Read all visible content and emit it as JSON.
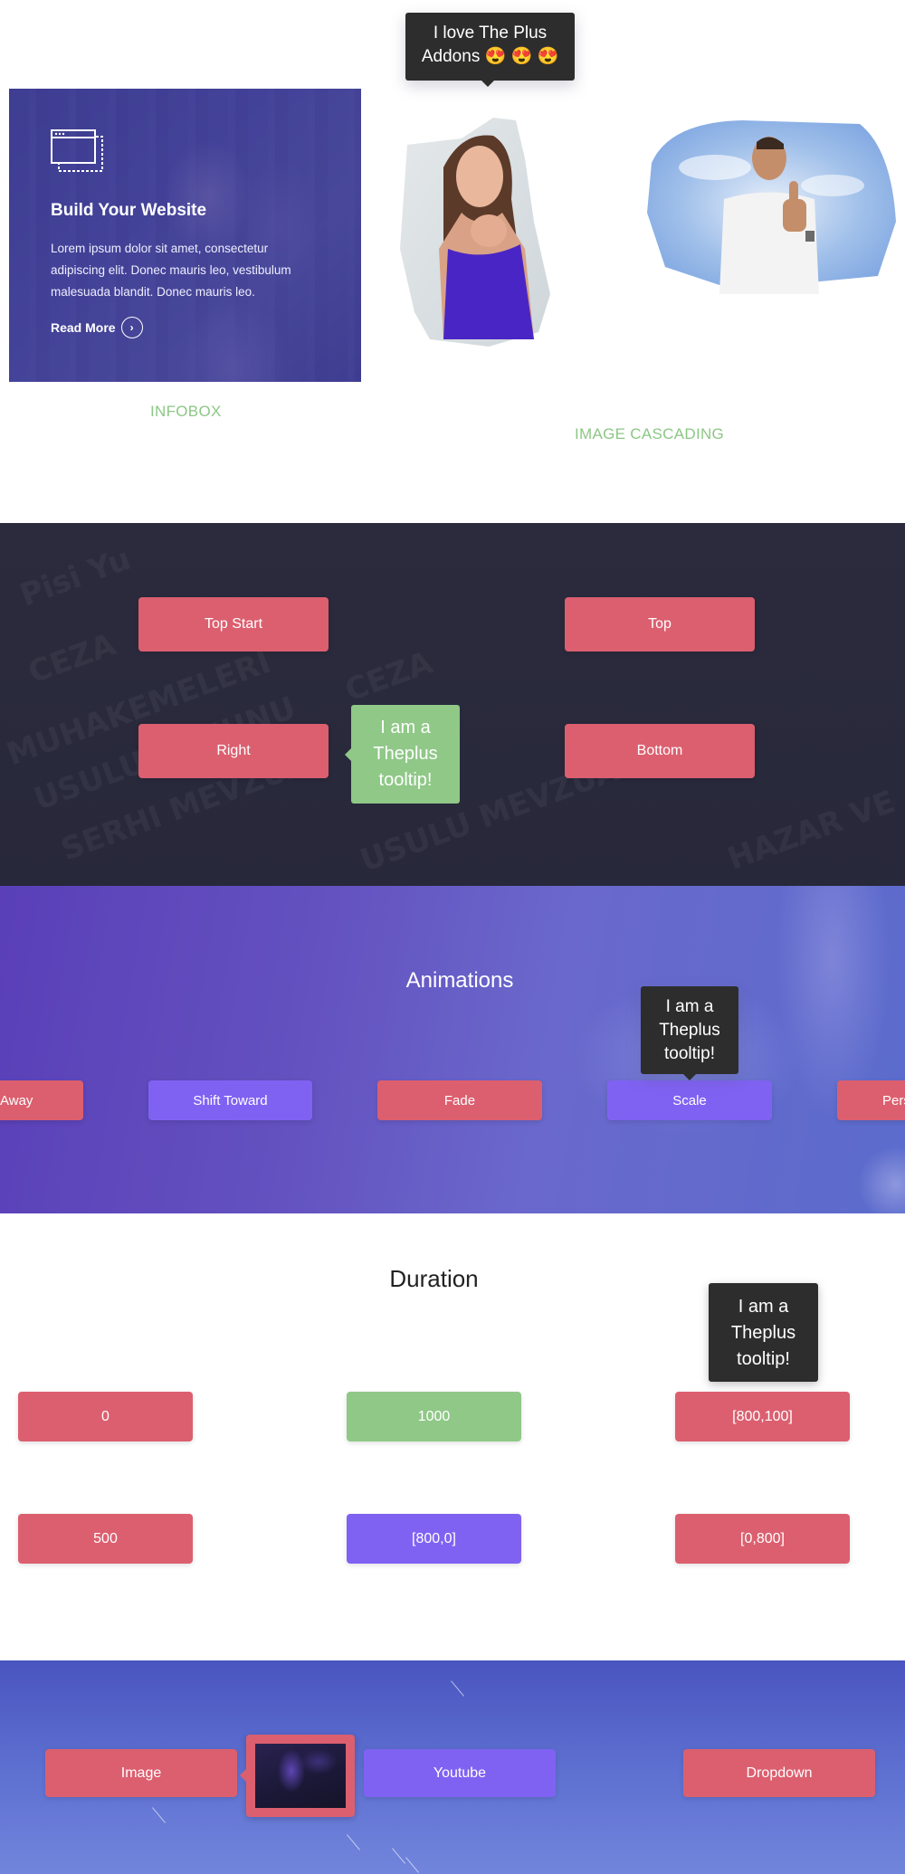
{
  "infobox": {
    "title": "Build Your Website",
    "text": "Lorem ipsum dolor sit amet, consectetur adipiscing elit. Donec mauris leo, vestibulum malesuada blandit. Donec mauris leo.",
    "read_more": "Read More",
    "icon": "browser-window-icon",
    "caption": "INFOBOX"
  },
  "image_cascading": {
    "tooltip": "I love The Plus Addons 😍 😍 😍",
    "caption": "IMAGE CASCADING",
    "images": [
      "woman-portrait",
      "man-thumbs-up"
    ]
  },
  "placements": {
    "buttons": [
      "Top Start",
      "Top",
      "Right",
      "Bottom"
    ],
    "tooltip": "I am a Theplus tooltip!"
  },
  "animations": {
    "title": "Animations",
    "buttons": [
      "Away",
      "Shift Toward",
      "Fade",
      "Scale",
      "Pers"
    ],
    "tooltip": "I am a Theplus tooltip!"
  },
  "duration": {
    "title": "Duration",
    "buttons": [
      "0",
      "1000",
      "[800,100]",
      "500",
      "[800,0]",
      "[0,800]"
    ],
    "tooltip": "I am a Theplus tooltip!"
  },
  "content_types": {
    "buttons": [
      "Image",
      "Youtube",
      "Dropdown"
    ]
  },
  "colors": {
    "red": "#dc5f6f",
    "purple": "#8062f2",
    "green": "#8fc887",
    "tooltip_dark": "#2d2d2d",
    "caption_green": "#8cc785"
  }
}
